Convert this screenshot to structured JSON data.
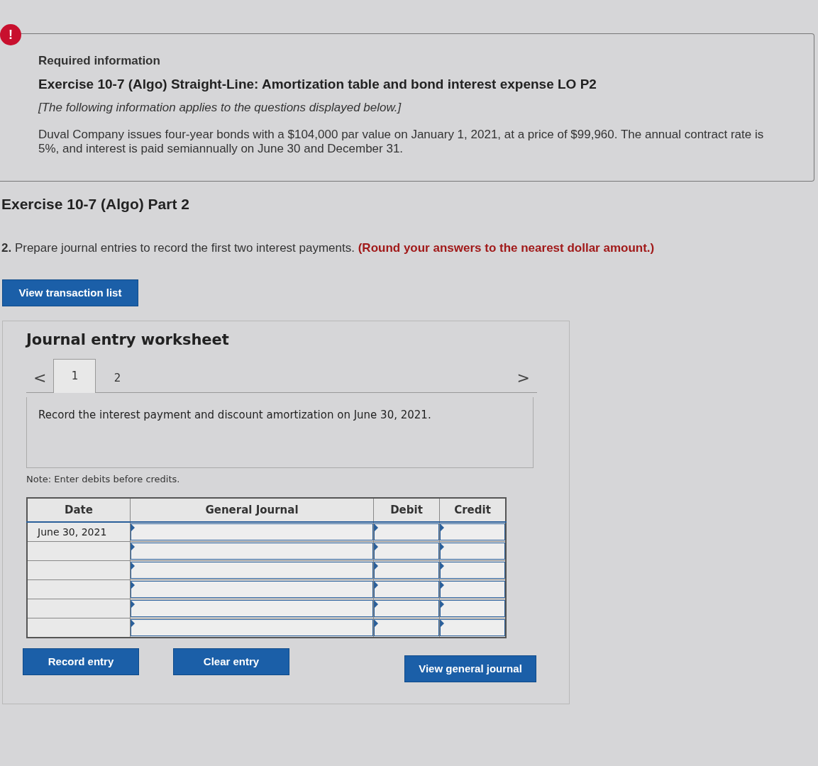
{
  "alert": {
    "icon": "!",
    "heading": "Required information",
    "title": "Exercise 10-7 (Algo) Straight-Line: Amortization table and bond interest expense LO P2",
    "note": "[The following information applies to the questions displayed below.]",
    "body": "Duval Company issues four-year bonds with a $104,000 par value on January 1, 2021, at a price of $99,960. The annual contract rate is 5%, and interest is paid semiannually on June 30 and December 31."
  },
  "part_title": "Exercise 10-7 (Algo) Part 2",
  "question": "**2.** Prepare journal entries to record the first two interest payments. **(Round your answers to the nearest dollar amount.)**",
  "transaction_button": "View transaction list",
  "worksheet": {
    "title": "Journal entry worksheet",
    "prev": "<",
    "next": ">",
    "tabs": [
      {
        "label": "1",
        "selected": true
      },
      {
        "label": "2",
        "selected": false
      }
    ],
    "instruction": "Record the interest payment and discount amortization on June 30, 2021.",
    "note": "Note: Enter debits before credits.",
    "columns": [
      "Date",
      "General Journal",
      "Debit",
      "Credit"
    ],
    "rows": [
      {
        "date": "June 30, 2021"
      },
      {},
      {},
      {},
      {},
      {}
    ],
    "buttons": [
      "Record entry",
      "Clear entry",
      "View general journal"
    ]
  }
}
